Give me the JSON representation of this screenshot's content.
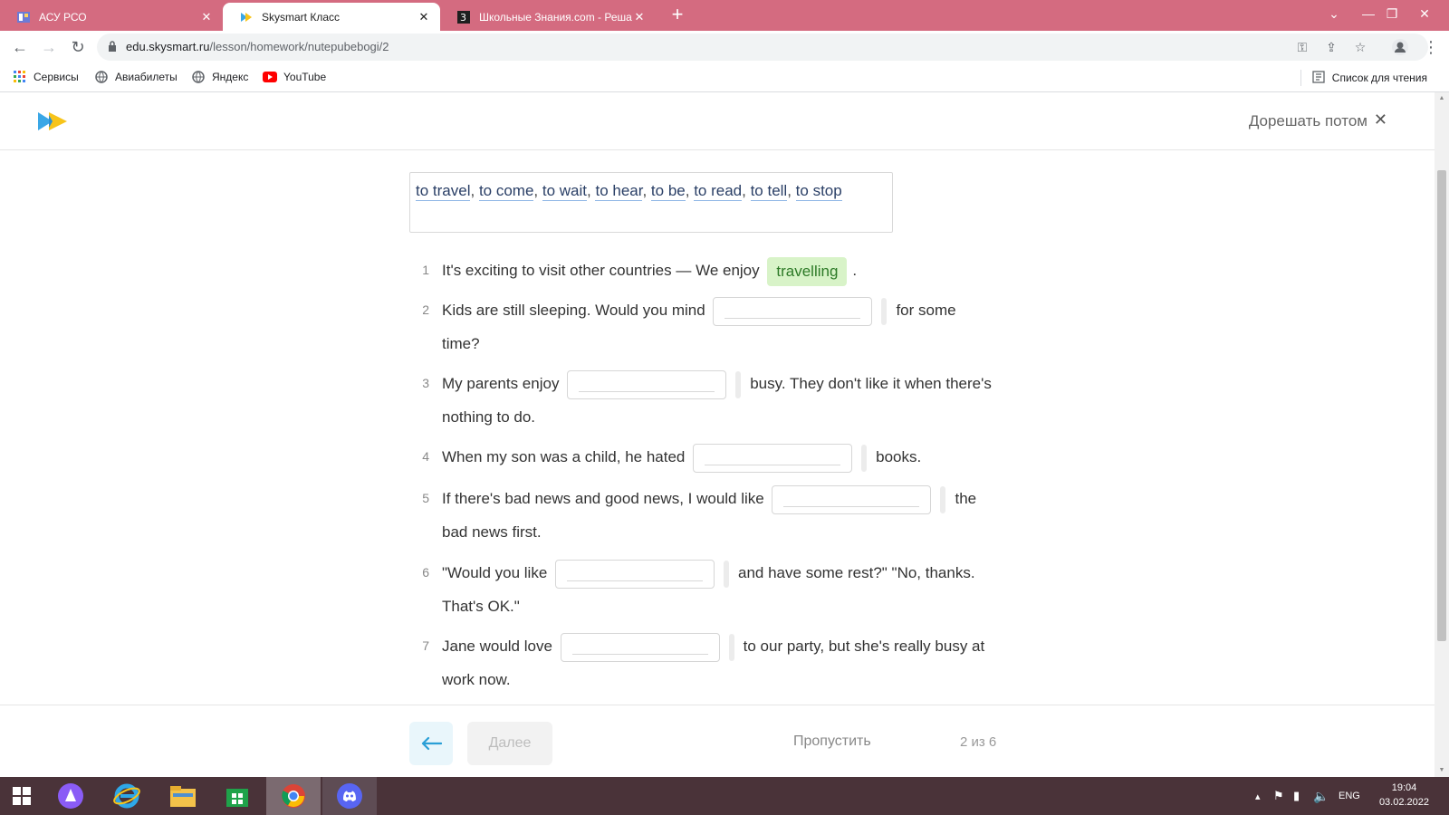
{
  "browser": {
    "tabs": [
      {
        "title": "АСУ РСО",
        "active": false
      },
      {
        "title": "Skysmart Класс",
        "active": true
      },
      {
        "title": "Школьные Знания.com - Решае",
        "active": false
      }
    ],
    "url": {
      "host": "edu.skysmart.ru",
      "path": "/lesson/homework/nutepubebogi/2"
    },
    "bookmarks": [
      {
        "label": "Сервисы",
        "icon": "apps-grid-icon"
      },
      {
        "label": "Авиабилеты",
        "icon": "globe-icon"
      },
      {
        "label": "Яндекс",
        "icon": "globe-icon"
      },
      {
        "label": "YouTube",
        "icon": "youtube-icon"
      }
    ],
    "reading_list": "Список для чтения"
  },
  "header": {
    "later_label": "Дорешать потом"
  },
  "word_bank": [
    "to travel",
    "to come",
    "to wait",
    "to hear",
    "to be",
    "to read",
    "to tell",
    "to stop"
  ],
  "questions": [
    {
      "num": "1",
      "line1_before": "It's exciting to visit other countries — We enjoy",
      "answer": "travelling",
      "line1_after": "."
    },
    {
      "num": "2",
      "line1_before": "Kids are still sleeping. Would you mind",
      "line1_after": "for some",
      "line2": "time?"
    },
    {
      "num": "3",
      "line1_before": "My parents enjoy",
      "line1_after": "busy. They don't like it when there's",
      "line2": "nothing to do."
    },
    {
      "num": "4",
      "line1_before": "When my son was a child, he hated",
      "line1_after": "books."
    },
    {
      "num": "5",
      "line1_before": "If there's bad news and good news, I would like",
      "line1_after": "the",
      "line2": "bad news first."
    },
    {
      "num": "6",
      "line1_before": "\"Would you like",
      "line1_after": "and have some rest?\" \"No, thanks.",
      "line2": "That's OK.\""
    },
    {
      "num": "7",
      "line1_before": "Jane would love",
      "line1_after": "to our party, but she's really busy at",
      "line2": "work now."
    }
  ],
  "footer": {
    "next_label": "Далее",
    "skip_label": "Пропустить",
    "progress": "2 из 6"
  },
  "taskbar": {
    "lang": "ENG",
    "time": "19:04",
    "date": "03.02.2022"
  },
  "colors": {
    "tabstrip": "#d46b80",
    "answer_bg": "#d8f3c8",
    "answer_text": "#2d7a27",
    "taskbar": "#4a3339"
  }
}
